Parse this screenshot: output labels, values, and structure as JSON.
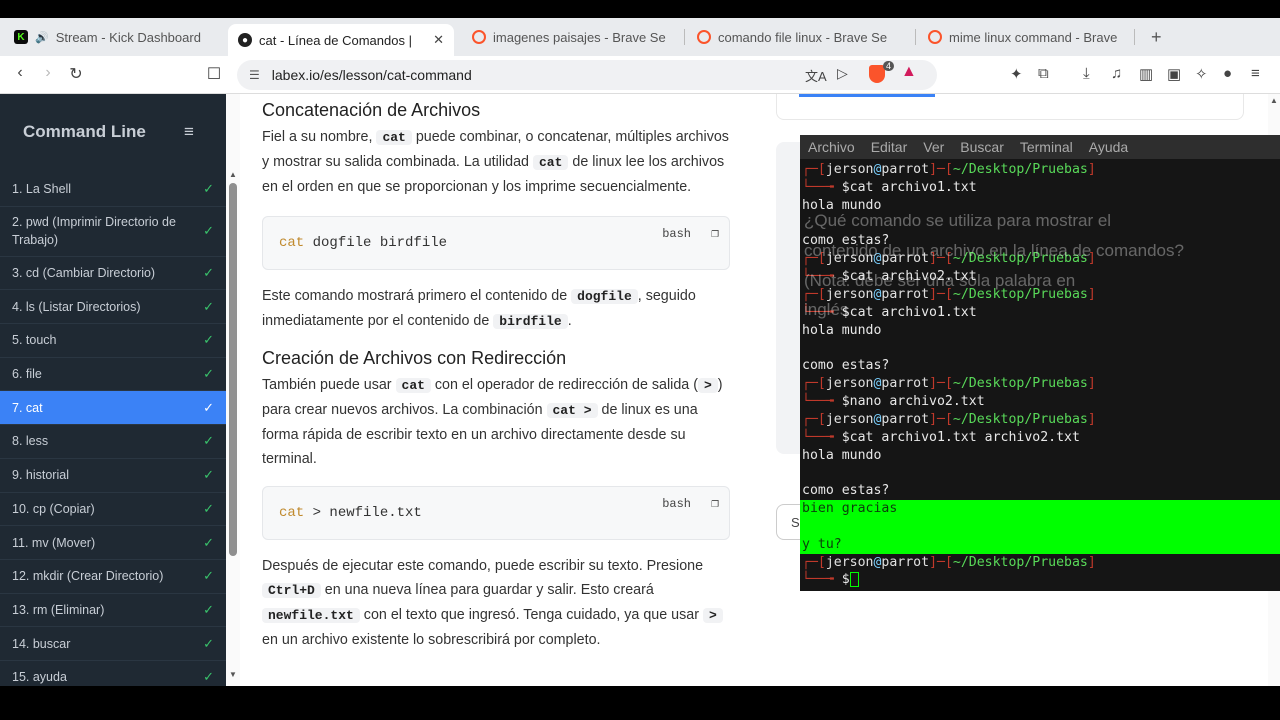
{
  "browser": {
    "tabs": [
      {
        "title": "Stream - Kick Dashboard",
        "icon": "kick-icon",
        "active": false
      },
      {
        "title": "cat - Línea de Comandos |",
        "icon": "labex-icon",
        "active": true
      },
      {
        "title": "imagenes paisajes - Brave Se",
        "icon": "brave-icon",
        "active": false
      },
      {
        "title": "comando file linux - Brave Se",
        "icon": "brave-icon",
        "active": false
      },
      {
        "title": "mime linux command - Brave",
        "icon": "brave-icon",
        "active": false
      }
    ],
    "url": "labex.io/es/lesson/cat-command",
    "shield_count": "4"
  },
  "sidebar": {
    "title": "Command Line",
    "items": [
      {
        "label": "1. La Shell"
      },
      {
        "label": "2. pwd (Imprimir Directorio de Trabajo)"
      },
      {
        "label": "3. cd (Cambiar Directorio)"
      },
      {
        "label": "4. ls (Listar Directorios)"
      },
      {
        "label": "5. touch"
      },
      {
        "label": "6. file"
      },
      {
        "label": "7. cat"
      },
      {
        "label": "8. less"
      },
      {
        "label": "9. historial"
      },
      {
        "label": "10. cp (Copiar)"
      },
      {
        "label": "11. mv (Mover)"
      },
      {
        "label": "12. mkdir (Crear Directorio)"
      },
      {
        "label": "13. rm (Eliminar)"
      },
      {
        "label": "14. buscar"
      },
      {
        "label": "15. ayuda"
      }
    ]
  },
  "content": {
    "h_concat": "Concatenación de Archivos",
    "p1a": "Fiel a su nombre, ",
    "p1_code1": "cat",
    "p1b": " puede combinar, o concatenar, múltiples archivos y mostrar su salida combinada. La utilidad ",
    "p1_code2": "cat",
    "p1c": " de linux lee los archivos en el orden en que se proporcionan y los imprime secuencialmente.",
    "code1_kw": "cat",
    "code1_rest": " dogfile birdfile",
    "code_lang": "bash",
    "p2a": "Este comando mostrará primero el contenido de ",
    "p2_code1": "dogfile",
    "p2b": ", seguido inmediatamente por el contenido de ",
    "p2_code2": "birdfile",
    "p2c": ".",
    "h_redir": "Creación de Archivos con Redirección",
    "p3a": "También puede usar ",
    "p3_code1": "cat",
    "p3b": " con el operador de redirección de salida (",
    "p3_code2": ">",
    "p3c": ") para crear nuevos archivos. La combinación ",
    "p3_code3": "cat >",
    "p3d": " de linux es una forma rápida de escribir texto en un archivo directamente desde su terminal.",
    "code2_kw": "cat",
    "code2_rest": " > newfile.txt",
    "p4a": "Después de ejecutar este comando, puede escribir su texto. Presione ",
    "p4_code1": "Ctrl+D",
    "p4b": " en una nueva línea para guardar y salir. Esto creará ",
    "p4_code2": "newfile.txt",
    "p4c": " con el texto que ingresó. Tenga cuidado, ya que usar ",
    "p4_code3": ">",
    "p4d": " en un archivo existente lo sobrescribirá por completo."
  },
  "rightpane": {
    "button_label": "S",
    "ghost_lines": [
      "¿Qué comando se utiliza para mostrar el",
      "contenido de un archivo en la línea de comandos?",
      "(Nota: debe ser una sola palabra en",
      "inglés"
    ]
  },
  "terminal": {
    "menu": [
      "Archivo",
      "Editar",
      "Ver",
      "Buscar",
      "Terminal",
      "Ayuda"
    ],
    "user": "jerson",
    "host": "parrot",
    "path": "~/Desktop/Pruebas",
    "lines": [
      {
        "type": "prompt"
      },
      {
        "type": "cmd",
        "text": "cat archivo1.txt"
      },
      {
        "type": "out",
        "text": "hola mundo"
      },
      {
        "type": "out",
        "text": ""
      },
      {
        "type": "out",
        "text": "como estas?"
      },
      {
        "type": "prompt"
      },
      {
        "type": "cmd",
        "text": "cat archivo2.txt"
      },
      {
        "type": "prompt"
      },
      {
        "type": "cmd",
        "text": "cat archivo1.txt"
      },
      {
        "type": "out",
        "text": "hola mundo"
      },
      {
        "type": "out",
        "text": ""
      },
      {
        "type": "out",
        "text": "como estas?"
      },
      {
        "type": "prompt"
      },
      {
        "type": "cmd",
        "text": "nano archivo2.txt"
      },
      {
        "type": "prompt"
      },
      {
        "type": "cmd",
        "text": "cat archivo1.txt archivo2.txt"
      },
      {
        "type": "out",
        "text": "hola mundo"
      },
      {
        "type": "out",
        "text": ""
      },
      {
        "type": "out",
        "text": "como estas?"
      },
      {
        "type": "hl",
        "text": "bien gracias"
      },
      {
        "type": "hl",
        "text": ""
      },
      {
        "type": "hl",
        "text": "y tu?"
      },
      {
        "type": "prompt"
      },
      {
        "type": "cursor"
      }
    ]
  }
}
